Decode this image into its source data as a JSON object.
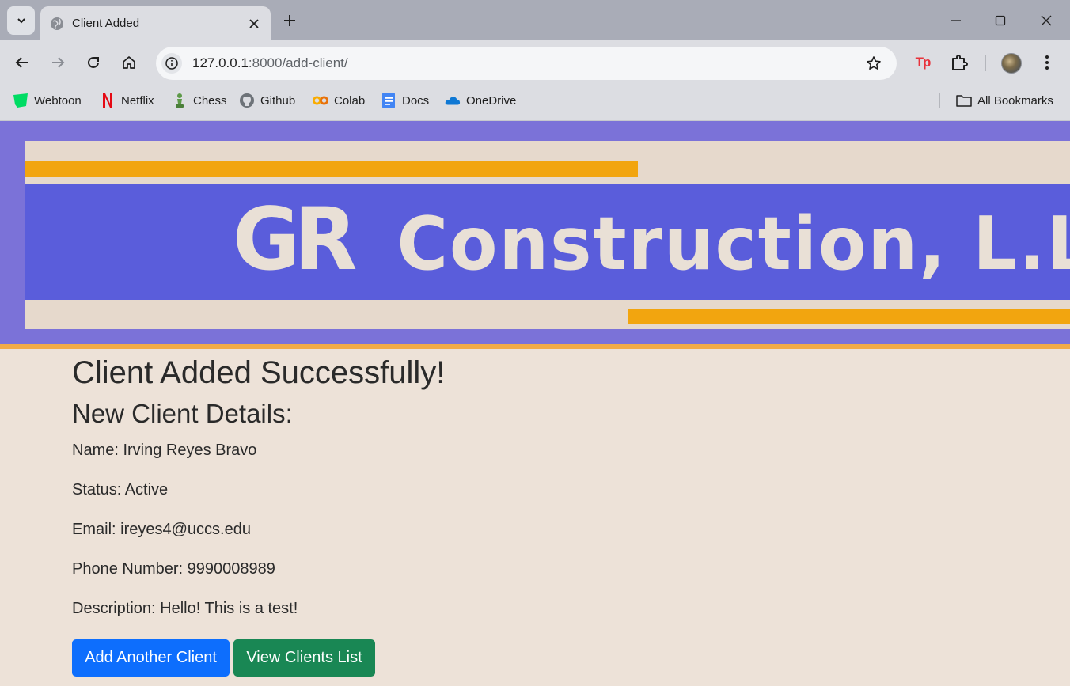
{
  "browser": {
    "tab": {
      "title": "Client Added"
    },
    "address_bar": {
      "host": "127.0.0.1",
      "rest": ":8000/add-client/"
    },
    "bookmarks": [
      {
        "label": "Webtoon",
        "icon": "webtoon-icon",
        "color": "#00dc64"
      },
      {
        "label": "Netflix",
        "icon": "netflix-icon",
        "color": "#e50914"
      },
      {
        "label": "Chess",
        "icon": "chess-icon",
        "color": "#5d9948"
      },
      {
        "label": "Github",
        "icon": "github-icon",
        "color": "#333333"
      },
      {
        "label": "Colab",
        "icon": "colab-icon",
        "color": "#f9ab00"
      },
      {
        "label": "Docs",
        "icon": "docs-icon",
        "color": "#4285f4"
      },
      {
        "label": "OneDrive",
        "icon": "onedrive-icon",
        "color": "#0364b8"
      }
    ],
    "all_bookmarks_label": "All Bookmarks"
  },
  "banner": {
    "logo_text": "GR",
    "company_text": "Construction, L.L.C."
  },
  "page": {
    "heading": "Client Added Successfully!",
    "subheading": "New Client Details:",
    "fields": [
      {
        "text": "Name: Irving Reyes Bravo"
      },
      {
        "text": "Status: Active"
      },
      {
        "text": "Email: ireyes4@uccs.edu"
      },
      {
        "text": "Phone Number: 9990008989"
      },
      {
        "text": "Description: Hello! This is a test!"
      }
    ],
    "buttons": {
      "add_another": "Add Another Client",
      "view_list": "View Clients List"
    }
  },
  "colors": {
    "header_bg": "#7b72d8",
    "header_border": "#f2ab46",
    "page_bg": "#ede2d8",
    "primary_button": "#0d6efd",
    "success_button": "#198754"
  }
}
